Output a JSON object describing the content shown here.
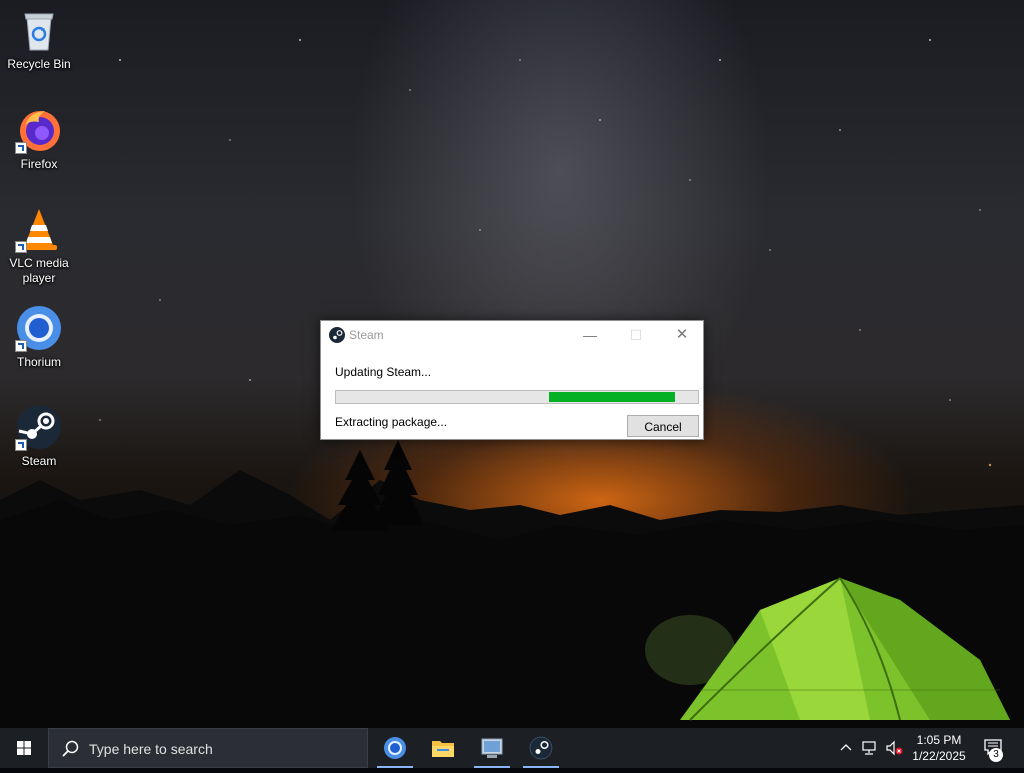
{
  "desktop": {
    "icons": [
      {
        "label": "Recycle Bin",
        "icon": "recycle-bin-icon"
      },
      {
        "label": "Firefox",
        "icon": "firefox-icon"
      },
      {
        "label": "VLC media player",
        "icon": "vlc-icon"
      },
      {
        "label": "Thorium",
        "icon": "thorium-icon"
      },
      {
        "label": "Steam",
        "icon": "steam-icon"
      }
    ]
  },
  "dialog": {
    "title": "Steam",
    "status_top": "Updating Steam...",
    "status_bottom": "Extracting package...",
    "cancel_label": "Cancel",
    "progress": {
      "start": 0.59,
      "end": 0.94
    },
    "progress_color": "#06b025",
    "buttons": {
      "minimize": "—",
      "maximize": "☐",
      "close": "✕"
    }
  },
  "taskbar": {
    "search_placeholder": "Type here to search",
    "apps": [
      "thorium-icon",
      "file-explorer-icon",
      "system-app-icon",
      "steam-icon"
    ],
    "clock_time": "1:05 PM",
    "clock_date": "1/22/2025",
    "notification_count": "3"
  }
}
